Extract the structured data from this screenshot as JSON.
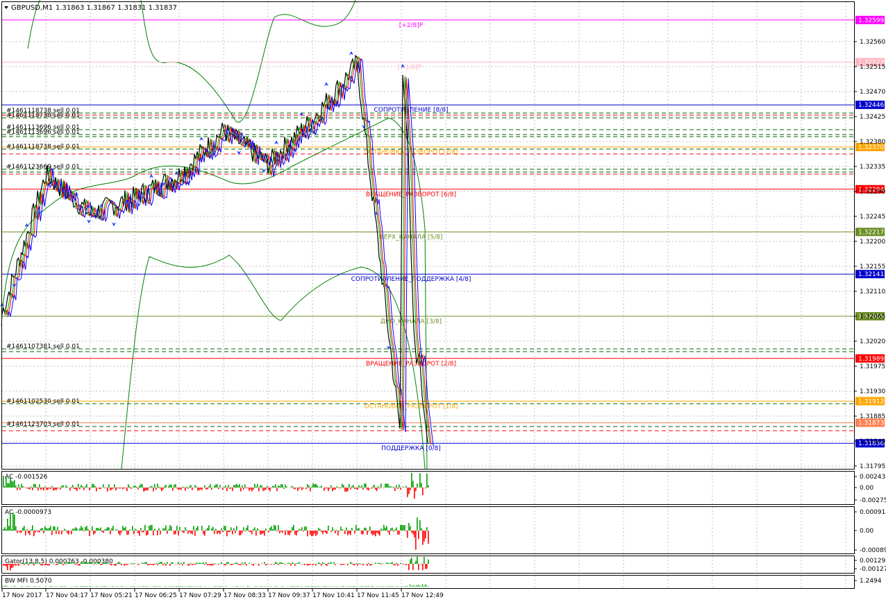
{
  "header": {
    "symbol": "GBPUSD,M1",
    "ohlc": "1.31863 1.31867 1.31831 1.31837"
  },
  "price_axis": {
    "ticks": [
      "1.32560",
      "1.32515",
      "1.32470",
      "1.32425",
      "1.32380",
      "1.32335",
      "1.32290",
      "1.32245",
      "1.32200",
      "1.32155",
      "1.32110",
      "1.32065",
      "1.32020",
      "1.31975",
      "1.31930",
      "1.31885",
      "1.31840",
      "1.31795"
    ]
  },
  "levels": [
    {
      "label": "[+2/8]P",
      "price": "1.32599",
      "color": "#ff00ff",
      "style": "solid"
    },
    {
      "label": "[+1/8]P",
      "price": "1.32523",
      "color": "#ffb6c1",
      "style": "solid"
    },
    {
      "label": "СОПРОТИВЛЕНИЕ [8/8]",
      "price": "1.32446",
      "color": "#0000cd",
      "style": "solid"
    },
    {
      "label": "ОСТАНОВКА_РАЗВОРОТ [7/8]",
      "price": "1.32370",
      "color": "#ffa500",
      "style": "solid"
    },
    {
      "label": "ВРАЩЕНИЕ_РАЗВОРОТ [6/8]",
      "price": "1.32294",
      "color": "#ff0000",
      "style": "solid"
    },
    {
      "label": "ВЕРХ_КАНАЛА [5/8]",
      "price": "1.32217",
      "color": "#6b8e23",
      "style": "solid"
    },
    {
      "label": "СОПРОТИВЛЕНИЕ_ПОДДЕРЖКА [4/8]",
      "price": "1.32141",
      "color": "#0000cd",
      "style": "solid"
    },
    {
      "label": "ДНО_КАНАЛА [3/8]",
      "price": "1.32065",
      "color": "#6b8e23",
      "style": "solid"
    },
    {
      "label": "ВРАЩЕНИЕ_РАЗВОРОТ [2/8]",
      "price": "1.31989",
      "color": "#ff0000",
      "style": "solid"
    },
    {
      "label": "ОСТАНОВКА_РАЗВОРОТ [1/8]",
      "price": "1.31912",
      "color": "#ffa500",
      "style": "solid"
    },
    {
      "label": "",
      "price": "1.31873",
      "color": "#ff7f50",
      "style": "solid"
    },
    {
      "label": "ПОДДЕРЖКА [0/8]",
      "price": "1.31836",
      "color": "#0000cd",
      "style": "solid"
    }
  ],
  "orders": [
    {
      "label": "#1461118738 sell 0.01"
    },
    {
      "label": "#1461118738 sell 0.01"
    },
    {
      "label": "#1461113696 sell 0.01"
    },
    {
      "label": "#1461113696 sell 0.01"
    },
    {
      "label": "#1461118738 sell 0.01"
    },
    {
      "label": "#1461123669 sell 0.01"
    },
    {
      "label": "#1461107381 sell 0.01"
    },
    {
      "label": "#1461102530 sell 0.01"
    },
    {
      "label": "#1461123703 sell 0.01"
    }
  ],
  "subwindows": [
    {
      "label": "AC -0.001526",
      "ticks": [
        "0.002436",
        "0.00",
        "-0.002751"
      ]
    },
    {
      "label": "AC -0.0000973",
      "ticks": [
        "0.000914",
        "0.00",
        "-0.000895"
      ]
    },
    {
      "label": "Gator(13,8,5) 0.000763 -0.000380",
      "ticks": [
        "0.001297",
        "-0.001275"
      ]
    },
    {
      "label": "BW MFI 0.5070",
      "ticks": [
        "1.2494"
      ]
    }
  ],
  "time_axis": {
    "labels": [
      "17 Nov 2017",
      "17 Nov 04:17",
      "17 Nov 05:21",
      "17 Nov 06:25",
      "17 Nov 07:29",
      "17 Nov 08:33",
      "17 Nov 09:37",
      "17 Nov 10:41",
      "17 Nov 11:45",
      "17 Nov 12:49"
    ]
  },
  "chart_data": {
    "type": "line",
    "symbol": "GBPUSD",
    "timeframe": "M1",
    "x": [
      "17 Nov 2017",
      "17 Nov 04:17",
      "17 Nov 05:21",
      "17 Nov 06:25",
      "17 Nov 07:29",
      "17 Nov 08:33",
      "17 Nov 09:37",
      "17 Nov 10:41",
      "17 Nov 11:45",
      "17 Nov 12:49"
    ],
    "series": [
      {
        "name": "close",
        "values": [
          1.3207,
          1.3232,
          1.3225,
          1.3228,
          1.3232,
          1.324,
          1.3234,
          1.3242,
          1.3252,
          1.3184
        ]
      }
    ],
    "ylim": [
      1.31795,
      1.3262
    ],
    "grid": true
  }
}
